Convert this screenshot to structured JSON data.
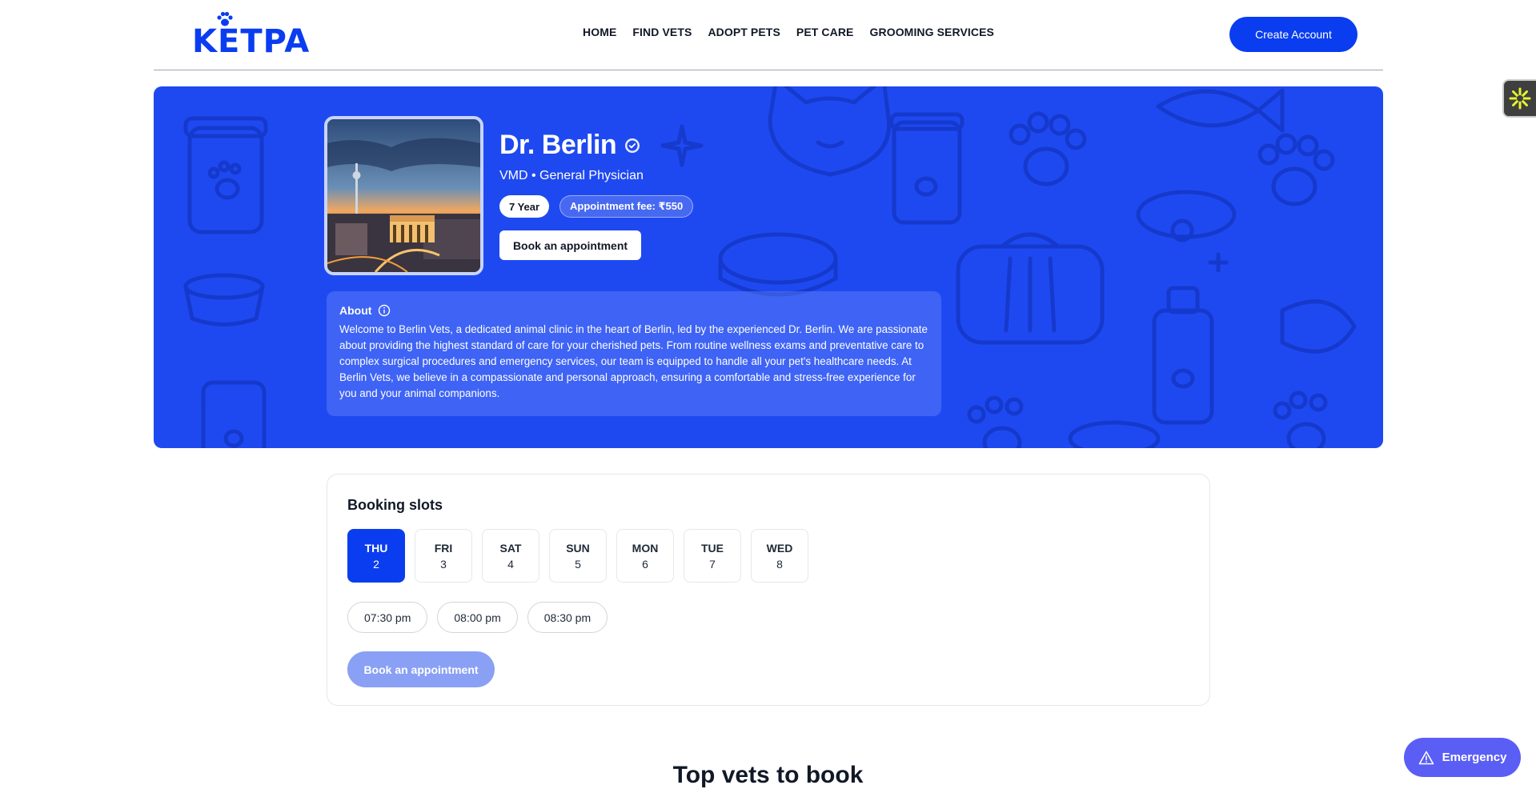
{
  "header": {
    "logo_text": "KETPA",
    "nav": [
      "HOME",
      "FIND VETS",
      "ADOPT PETS",
      "PET CARE",
      "GROOMING SERVICES"
    ],
    "create_account": "Create Account"
  },
  "doctor": {
    "name": "Dr. Berlin",
    "subtitle": "VMD • General Physician",
    "experience": "7 Year",
    "fee": "Appointment fee: ₹550",
    "book_label": "Book an appointment",
    "about_label": "About",
    "about_text": "Welcome to Berlin Vets, a dedicated animal clinic in the heart of Berlin, led by the experienced Dr. Berlin. We are passionate about providing the highest standard of care for your cherished pets. From routine wellness exams and preventative care to complex surgical procedures and emergency services, our team is equipped to handle all your pet's healthcare needs. At Berlin Vets, we believe in a compassionate and personal approach, ensuring a comfortable and stress-free experience for you and your animal companions."
  },
  "booking": {
    "title": "Booking slots",
    "days": [
      {
        "name": "THU",
        "num": "2",
        "active": true
      },
      {
        "name": "FRI",
        "num": "3",
        "active": false
      },
      {
        "name": "SAT",
        "num": "4",
        "active": false
      },
      {
        "name": "SUN",
        "num": "5",
        "active": false
      },
      {
        "name": "MON",
        "num": "6",
        "active": false
      },
      {
        "name": "TUE",
        "num": "7",
        "active": false
      },
      {
        "name": "WED",
        "num": "8",
        "active": false
      }
    ],
    "times": [
      "07:30 pm",
      "08:00 pm",
      "08:30 pm"
    ],
    "book_label": "Book an appointment"
  },
  "section_title": "Top vets to book",
  "emergency_label": "Emergency",
  "colors": {
    "brand": "#0a3df0",
    "hero_bg": "#1f49f0",
    "emergency": "#5a5ef5",
    "disabled_button": "#8aa0f5"
  }
}
